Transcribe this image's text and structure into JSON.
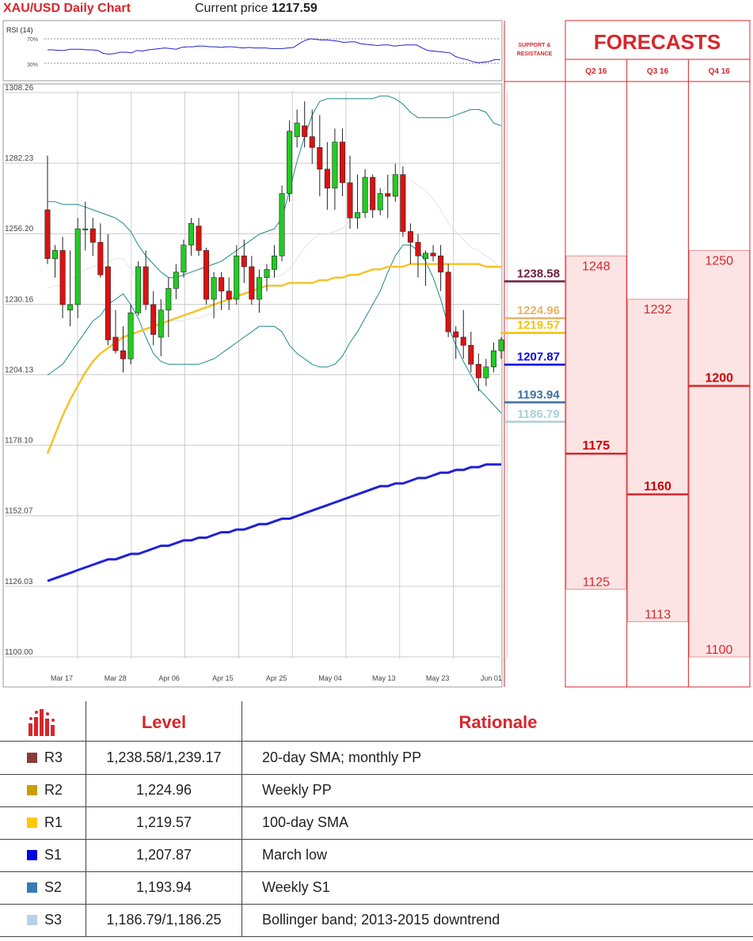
{
  "header": {
    "title": "XAU/USD Daily Chart",
    "price_label": "Current price",
    "price_value": "1217.59"
  },
  "rsi": {
    "label": "RSI (14)",
    "levels": [
      "70%",
      "30%"
    ],
    "values": [
      52,
      52,
      51,
      51,
      53,
      53,
      53,
      52,
      52,
      51,
      46,
      45,
      46,
      48,
      48,
      47,
      51,
      50,
      52,
      53,
      54,
      55,
      54,
      53,
      56,
      57,
      57,
      58,
      58,
      57,
      57,
      56,
      57,
      57,
      56,
      55,
      56,
      55,
      55,
      55,
      54,
      54,
      54,
      55,
      56,
      62,
      67,
      70,
      69,
      68,
      68,
      67,
      66,
      64,
      65,
      65,
      62,
      61,
      60,
      59,
      60,
      60,
      58,
      59,
      60,
      60,
      60,
      55,
      51,
      50,
      49,
      48,
      47,
      41,
      38,
      36,
      33,
      31,
      32,
      33,
      36,
      36
    ]
  },
  "chart_data": {
    "type": "candlestick",
    "title": "XAU/USD Daily Chart",
    "y_ticks": [
      "1308.26",
      "1282.23",
      "1256.20",
      "1230.16",
      "1204.13",
      "1178.10",
      "1152.07",
      "1126.03",
      "1100.00"
    ],
    "ylim": [
      1100.0,
      1308.26
    ],
    "x_ticks": [
      "Mar 17",
      "Mar 28",
      "Apr 06",
      "Apr 15",
      "Apr 25",
      "May 04",
      "May 13",
      "May 23",
      "Jun 01"
    ],
    "grid": true,
    "candles": [
      [
        1265,
        1285,
        1245,
        1247
      ],
      [
        1247,
        1252,
        1240,
        1250
      ],
      [
        1250,
        1255,
        1225,
        1230
      ],
      [
        1228,
        1250,
        1222,
        1230
      ],
      [
        1230,
        1262,
        1225,
        1258
      ],
      [
        1258,
        1268,
        1250,
        1258
      ],
      [
        1258,
        1262,
        1248,
        1253
      ],
      [
        1253,
        1260,
        1240,
        1241
      ],
      [
        1244,
        1256,
        1215,
        1217
      ],
      [
        1218,
        1228,
        1212,
        1213
      ],
      [
        1213,
        1222,
        1205,
        1210
      ],
      [
        1210,
        1230,
        1208,
        1227
      ],
      [
        1227,
        1246,
        1226,
        1244
      ],
      [
        1244,
        1250,
        1228,
        1230
      ],
      [
        1230,
        1235,
        1215,
        1219
      ],
      [
        1218,
        1232,
        1211,
        1228
      ],
      [
        1228,
        1240,
        1218,
        1236
      ],
      [
        1236,
        1245,
        1232,
        1242
      ],
      [
        1242,
        1254,
        1240,
        1252
      ],
      [
        1252,
        1262,
        1248,
        1260
      ],
      [
        1259,
        1262,
        1248,
        1250
      ],
      [
        1250,
        1251,
        1230,
        1232
      ],
      [
        1232,
        1242,
        1225,
        1240
      ],
      [
        1240,
        1242,
        1228,
        1235
      ],
      [
        1235,
        1240,
        1228,
        1232
      ],
      [
        1232,
        1252,
        1230,
        1248
      ],
      [
        1248,
        1254,
        1238,
        1244
      ],
      [
        1244,
        1248,
        1230,
        1232
      ],
      [
        1232,
        1243,
        1227,
        1240
      ],
      [
        1240,
        1245,
        1235,
        1243
      ],
      [
        1243,
        1252,
        1240,
        1248
      ],
      [
        1248,
        1274,
        1246,
        1271
      ],
      [
        1271,
        1298,
        1268,
        1294
      ],
      [
        1292,
        1302,
        1288,
        1297
      ],
      [
        1296,
        1305,
        1288,
        1292
      ],
      [
        1292,
        1302,
        1282,
        1288
      ],
      [
        1288,
        1300,
        1270,
        1280
      ],
      [
        1280,
        1290,
        1265,
        1273
      ],
      [
        1273,
        1295,
        1265,
        1290
      ],
      [
        1290,
        1295,
        1270,
        1275
      ],
      [
        1275,
        1285,
        1258,
        1262
      ],
      [
        1262,
        1278,
        1258,
        1264
      ],
      [
        1264,
        1280,
        1262,
        1277
      ],
      [
        1277,
        1278,
        1262,
        1265
      ],
      [
        1265,
        1273,
        1263,
        1271
      ],
      [
        1271,
        1278,
        1262,
        1270
      ],
      [
        1270,
        1282,
        1268,
        1278
      ],
      [
        1278,
        1281,
        1255,
        1257
      ],
      [
        1257,
        1260,
        1245,
        1253
      ],
      [
        1253,
        1256,
        1240,
        1248
      ],
      [
        1247,
        1250,
        1237,
        1249
      ],
      [
        1249,
        1252,
        1246,
        1248
      ],
      [
        1248,
        1252,
        1235,
        1242
      ],
      [
        1242,
        1245,
        1218,
        1220
      ],
      [
        1220,
        1222,
        1210,
        1218
      ],
      [
        1218,
        1228,
        1210,
        1215
      ],
      [
        1215,
        1220,
        1205,
        1208
      ],
      [
        1208,
        1212,
        1198,
        1203
      ],
      [
        1203,
        1210,
        1200,
        1207
      ],
      [
        1207,
        1216,
        1205,
        1213
      ],
      [
        1213,
        1218,
        1210,
        1217
      ]
    ],
    "sma100": [
      1175,
      1182,
      1189,
      1195,
      1200,
      1205,
      1209,
      1212,
      1214,
      1216,
      1218,
      1219,
      1220,
      1221,
      1222,
      1223,
      1224,
      1225,
      1226,
      1227,
      1228,
      1229,
      1230,
      1231,
      1232,
      1233,
      1234,
      1235,
      1236,
      1237,
      1237,
      1237,
      1238,
      1238,
      1238,
      1238,
      1239,
      1239,
      1240,
      1240,
      1241,
      1241,
      1242,
      1243,
      1243,
      1244,
      1244,
      1244,
      1245,
      1245,
      1245,
      1245,
      1245,
      1245,
      1245,
      1245,
      1245,
      1245,
      1244,
      1244,
      1244
    ],
    "sma200": [
      1128,
      1129,
      1130,
      1131,
      1132,
      1133,
      1134,
      1135,
      1136,
      1136,
      1137,
      1138,
      1138,
      1139,
      1140,
      1141,
      1141,
      1142,
      1143,
      1143,
      1144,
      1144,
      1145,
      1146,
      1146,
      1147,
      1147,
      1148,
      1149,
      1149,
      1150,
      1151,
      1151,
      1152,
      1153,
      1154,
      1155,
      1156,
      1157,
      1158,
      1159,
      1160,
      1161,
      1162,
      1163,
      1163,
      1164,
      1164,
      1165,
      1166,
      1166,
      1167,
      1168,
      1168,
      1169,
      1169,
      1170,
      1170,
      1171,
      1171,
      1171
    ],
    "boll_upper": [
      1268,
      1268,
      1267,
      1267,
      1267,
      1266,
      1265,
      1264,
      1263,
      1262,
      1260,
      1257,
      1252,
      1248,
      1245,
      1242,
      1240,
      1240,
      1241,
      1242,
      1243,
      1244,
      1245,
      1246,
      1248,
      1250,
      1252,
      1254,
      1256,
      1257,
      1258,
      1262,
      1272,
      1283,
      1292,
      1300,
      1305,
      1306,
      1306,
      1306,
      1306,
      1306,
      1306,
      1306,
      1307,
      1307,
      1306,
      1304,
      1301,
      1299,
      1299,
      1299,
      1299,
      1299,
      1300,
      1301,
      1302,
      1302,
      1301,
      1297,
      1296
    ],
    "boll_lower": [
      1204,
      1206,
      1208,
      1212,
      1216,
      1220,
      1224,
      1226,
      1230,
      1232,
      1234,
      1230,
      1225,
      1218,
      1212,
      1209,
      1208,
      1208,
      1208,
      1208,
      1208,
      1209,
      1210,
      1212,
      1214,
      1216,
      1218,
      1220,
      1222,
      1222,
      1222,
      1220,
      1215,
      1212,
      1210,
      1208,
      1207,
      1207,
      1208,
      1211,
      1216,
      1220,
      1225,
      1230,
      1235,
      1242,
      1248,
      1252,
      1252,
      1250,
      1246,
      1240,
      1232,
      1222,
      1215,
      1209,
      1204,
      1199,
      1196,
      1193,
      1190
    ],
    "boll_mid": [
      1236,
      1237,
      1237,
      1239,
      1241,
      1243,
      1244,
      1245,
      1246,
      1247,
      1247,
      1243,
      1238,
      1233,
      1228,
      1225,
      1224,
      1224,
      1224,
      1225,
      1225,
      1226,
      1227,
      1229,
      1231,
      1233,
      1235,
      1237,
      1239,
      1239,
      1240,
      1241,
      1243,
      1247,
      1251,
      1254,
      1256,
      1256,
      1257,
      1258,
      1261,
      1263,
      1265,
      1268,
      1271,
      1274,
      1277,
      1278,
      1276,
      1274,
      1272,
      1269,
      1265,
      1260,
      1257,
      1254,
      1251,
      1250,
      1248,
      1246,
      1243
    ]
  },
  "levels": [
    {
      "label": "1238.58",
      "value": 1238.58,
      "color": "#6b1f3c"
    },
    {
      "label": "1224.96",
      "value": 1224.96,
      "color": "#e6b36a"
    },
    {
      "label": "1219.57",
      "value": 1219.57,
      "color": "#f2c300"
    },
    {
      "label": "1207.87",
      "value": 1207.87,
      "color": "#0a0ae0"
    },
    {
      "label": "1193.94",
      "value": 1193.94,
      "color": "#3d6fa0"
    },
    {
      "label": "1186.79",
      "value": 1186.79,
      "color": "#a8d0d8"
    }
  ],
  "forecasts": {
    "support_title": "SUPPORT & RESISTANCE",
    "title": "FORECASTS",
    "columns": [
      {
        "label": "Q2 16",
        "high": "1248",
        "median": "1175",
        "low": "1125",
        "h": 1248,
        "m": 1175,
        "l": 1125
      },
      {
        "label": "Q3 16",
        "high": "1232",
        "median": "1160",
        "low": "1113",
        "h": 1232,
        "m": 1160,
        "l": 1113
      },
      {
        "label": "Q4 16",
        "high": "1250",
        "median": "1200",
        "low": "1100",
        "h": 1250,
        "m": 1200,
        "l": 1100
      }
    ]
  },
  "table": {
    "headers": {
      "level": "Level",
      "rationale": "Rationale"
    },
    "rows": [
      {
        "name": "R3",
        "level": "1,238.58/1,239.17",
        "rationale": "20-day SMA; monthly PP",
        "color": "#8b3a3a"
      },
      {
        "name": "R2",
        "level": "1,224.96",
        "rationale": "Weekly PP",
        "color": "#c8a000"
      },
      {
        "name": "R1",
        "level": "1,219.57",
        "rationale": "100-day SMA",
        "color": "#ffc800"
      },
      {
        "name": "S1",
        "level": "1,207.87",
        "rationale": "March low",
        "color": "#0000e0"
      },
      {
        "name": "S2",
        "level": "1,193.94",
        "rationale": "Weekly S1",
        "color": "#3a7ab8"
      },
      {
        "name": "S3",
        "level": "1,186.79/1,186.25",
        "rationale": "Bollinger band; 2013-2015 downtrend",
        "color": "#b8d0e8"
      }
    ]
  }
}
